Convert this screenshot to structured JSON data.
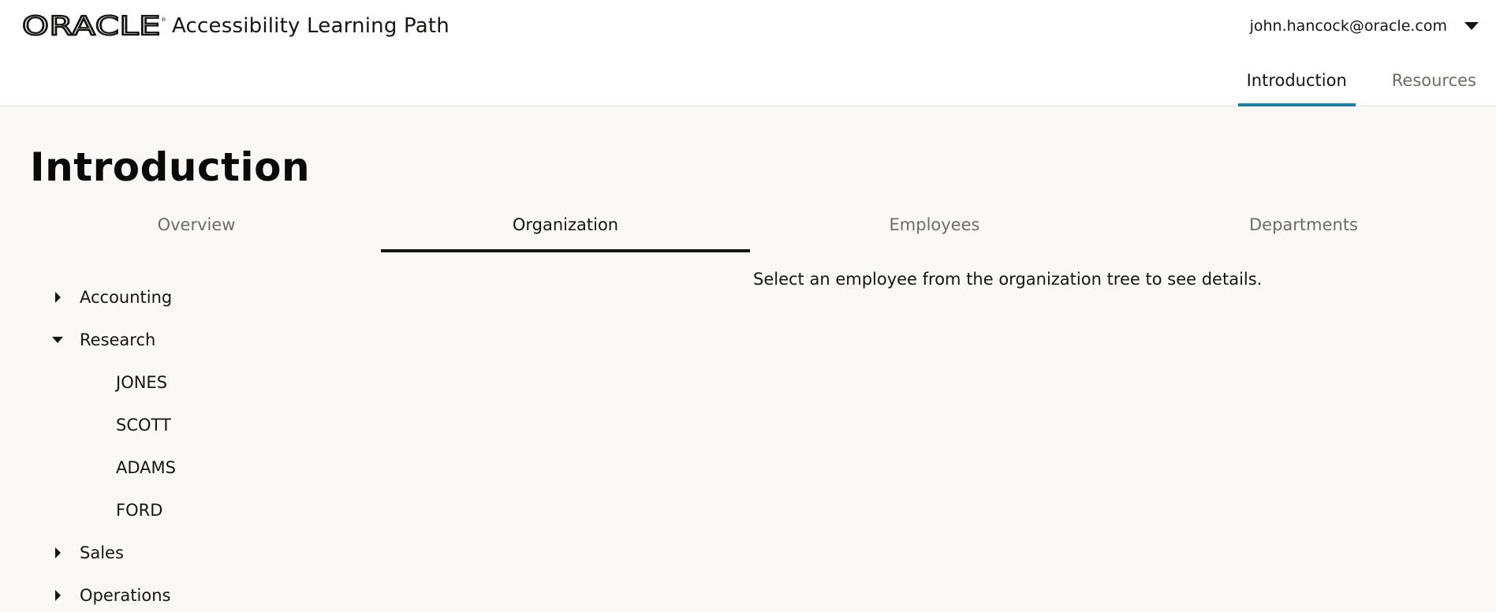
{
  "header": {
    "brand": "ORACLE",
    "app_title": "Accessibility Learning Path",
    "user_email": "john.hancock@oracle.com",
    "nav": [
      {
        "label": "Introduction",
        "active": true
      },
      {
        "label": "Resources",
        "active": false
      }
    ]
  },
  "main": {
    "page_title": "Introduction",
    "tabs": [
      {
        "label": "Overview",
        "active": false
      },
      {
        "label": "Organization",
        "active": true
      },
      {
        "label": "Employees",
        "active": false
      },
      {
        "label": "Departments",
        "active": false
      }
    ],
    "tree": {
      "departments": [
        {
          "label": "Accounting",
          "expanded": false
        },
        {
          "label": "Research",
          "expanded": true,
          "employees": [
            "JONES",
            "SCOTT",
            "ADAMS",
            "FORD"
          ]
        },
        {
          "label": "Sales",
          "expanded": false
        },
        {
          "label": "Operations",
          "expanded": false
        }
      ]
    },
    "details_message": "Select an employee from the organization tree to see details."
  },
  "colors": {
    "nav_active_underline": "#227e9e",
    "tab_active_underline": "#161513",
    "main_background": "#f9f8f6",
    "muted_text": "#6f6c68"
  },
  "icons": {
    "user_menu": "caret-down-icon",
    "collapsed": "caret-right-icon",
    "expanded": "caret-down-icon"
  }
}
